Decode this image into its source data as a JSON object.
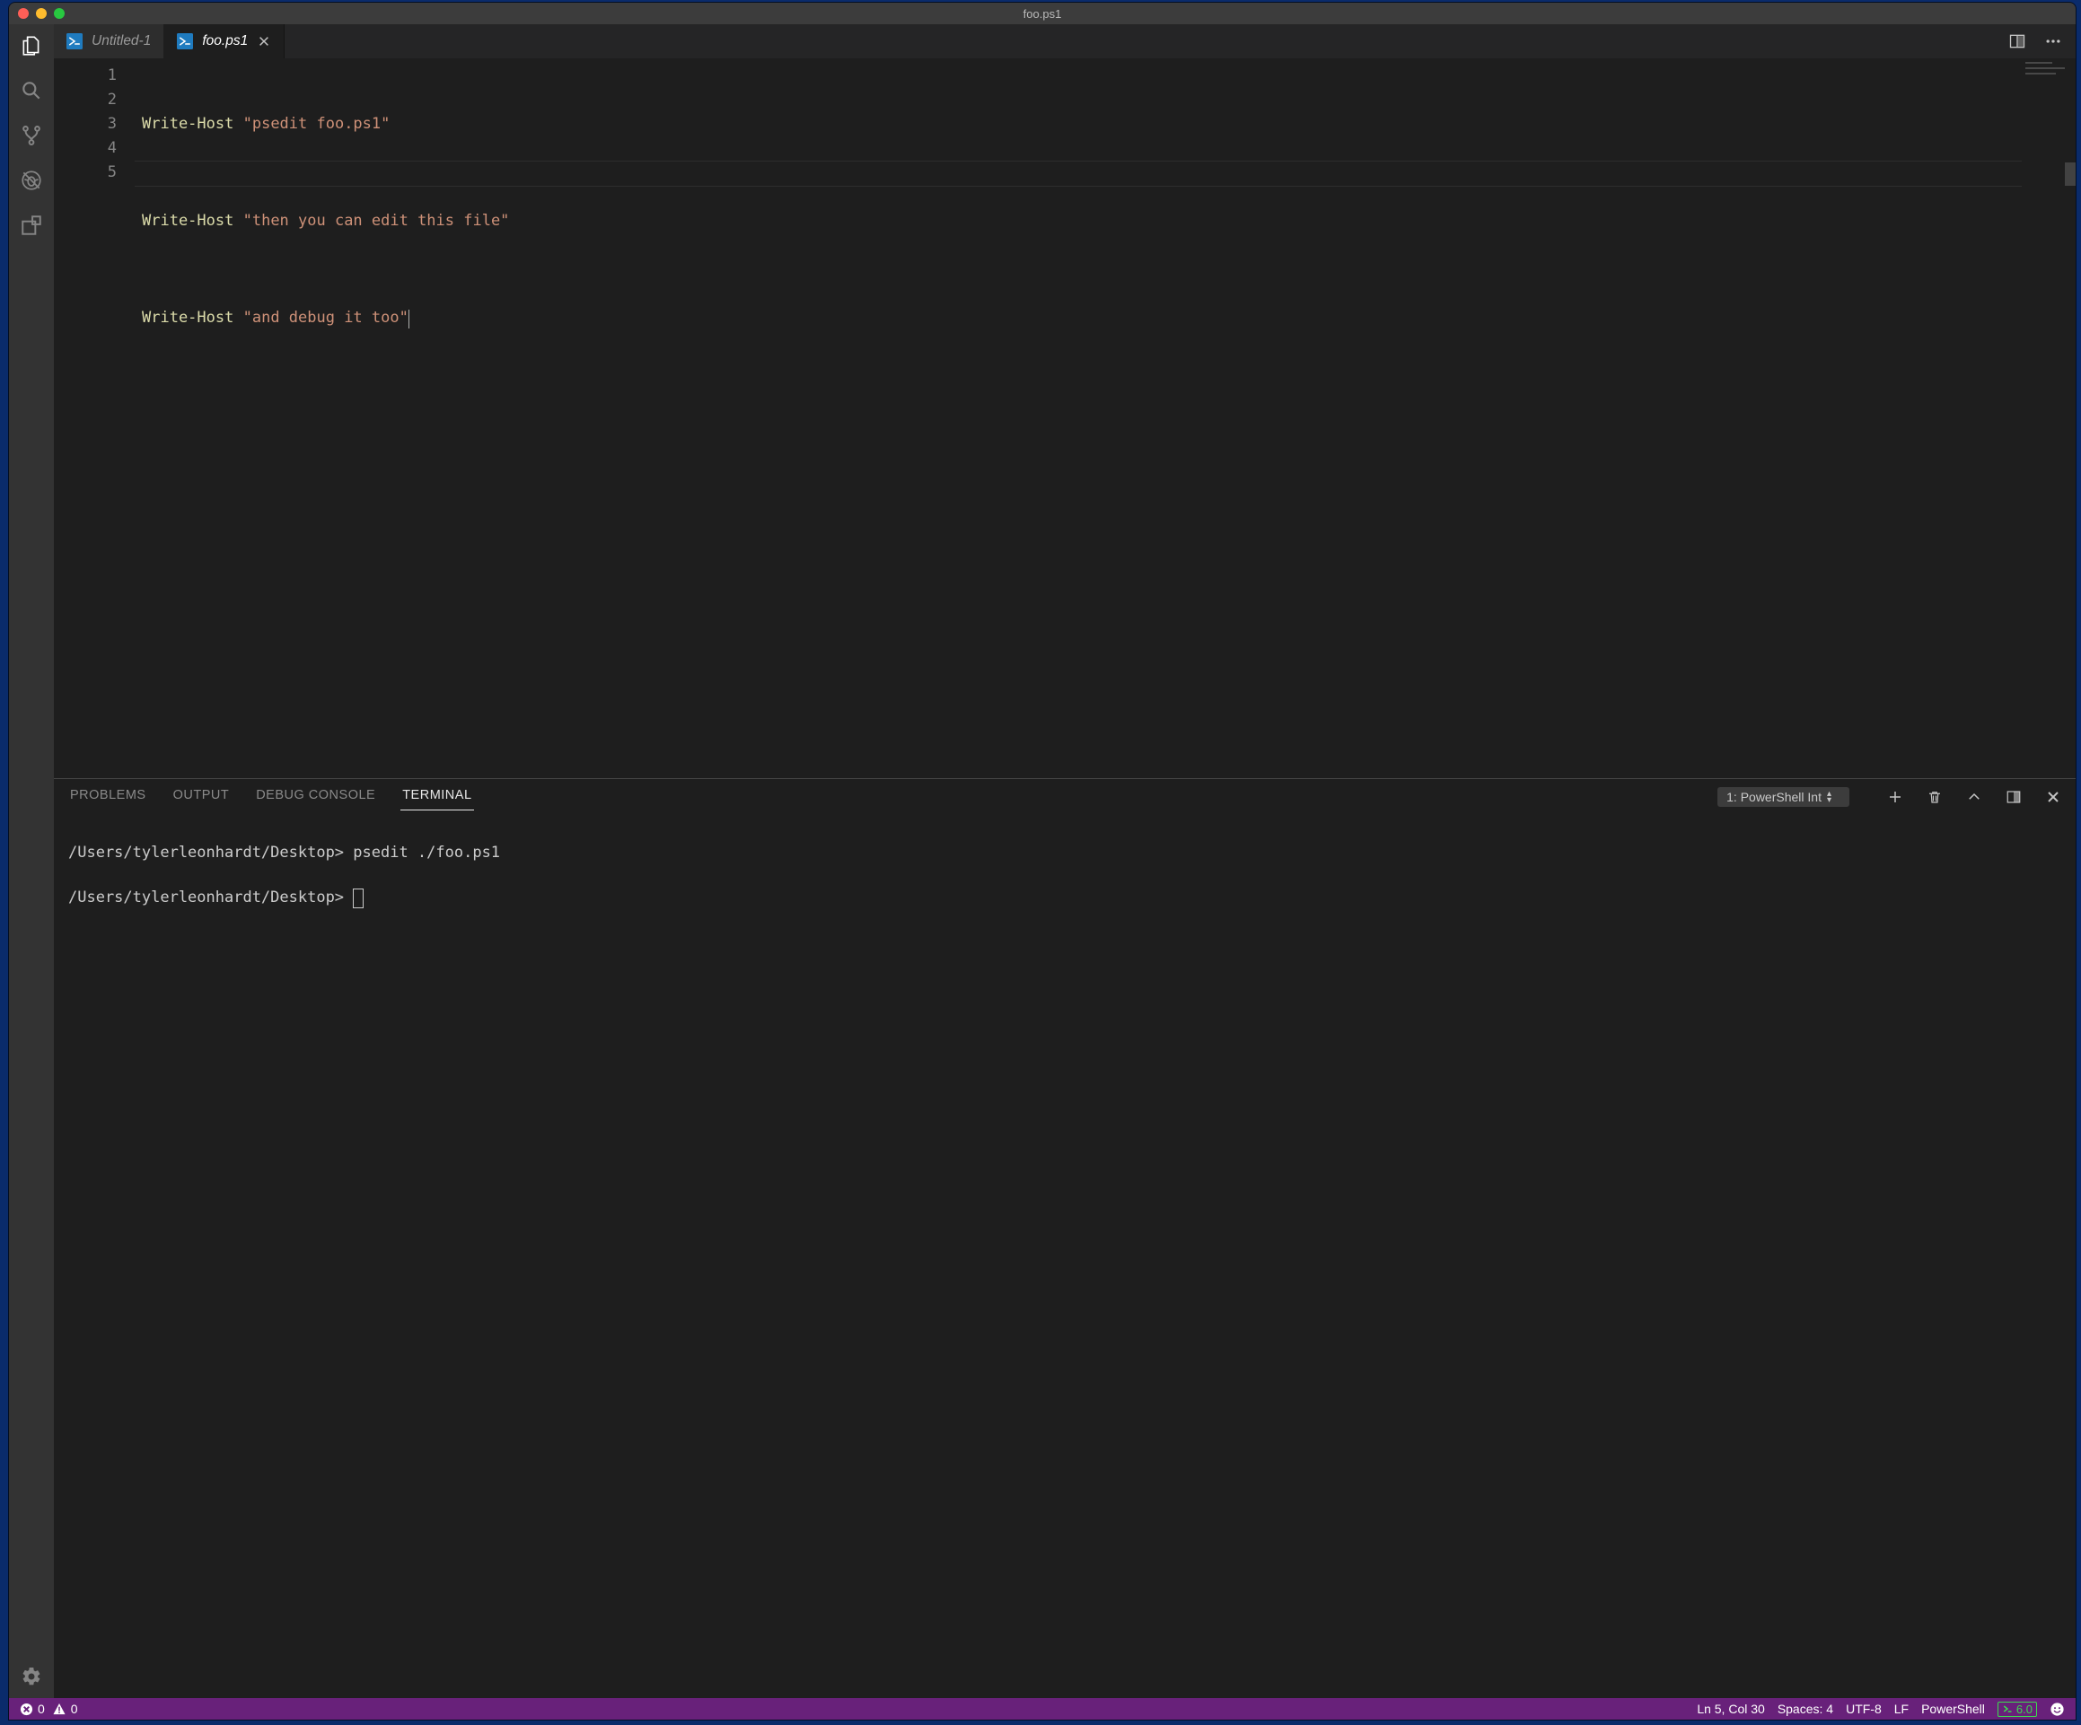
{
  "titlebar": {
    "title": "foo.ps1"
  },
  "tabs": [
    {
      "label": "Untitled-1",
      "active": false
    },
    {
      "label": "foo.ps1",
      "active": true
    }
  ],
  "editor": {
    "line_numbers": [
      "1",
      "2",
      "3",
      "4",
      "5"
    ],
    "lines": [
      {
        "cmd": "Write-Host",
        "str": "\"psedit foo.ps1\""
      },
      {
        "cmd": "",
        "str": ""
      },
      {
        "cmd": "Write-Host",
        "str": "\"then you can edit this file\""
      },
      {
        "cmd": "",
        "str": ""
      },
      {
        "cmd": "Write-Host",
        "str": "\"and debug it too\""
      }
    ],
    "cursor_line_index": 4
  },
  "panel": {
    "tabs": {
      "problems": "PROBLEMS",
      "output": "OUTPUT",
      "debug_console": "DEBUG CONSOLE",
      "terminal": "TERMINAL"
    },
    "terminal_selector": "1: PowerShell Int",
    "terminal_lines": [
      "/Users/tylerleonhardt/Desktop> psedit ./foo.ps1",
      "/Users/tylerleonhardt/Desktop> "
    ]
  },
  "statusbar": {
    "errors": "0",
    "warnings": "0",
    "ln_col": "Ln 5, Col 30",
    "spaces": "Spaces: 4",
    "encoding": "UTF-8",
    "eol": "LF",
    "language": "PowerShell",
    "ps_version": "6.0"
  }
}
